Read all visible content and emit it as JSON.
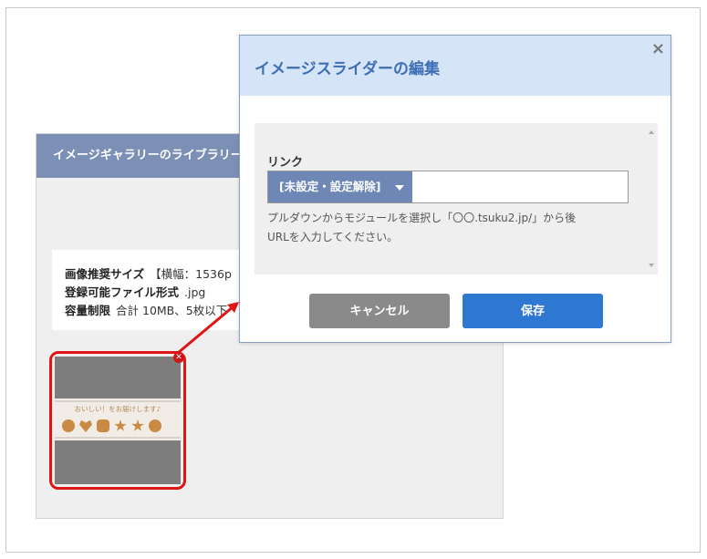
{
  "library_panel": {
    "header_title": "イメージギャラリーのライブラリー",
    "info": {
      "recommended_size_label": "画像推奨サイズ",
      "recommended_size_value": "【横幅：1536p",
      "file_format_label": "登録可能ファイル形式",
      "file_format_value": ".jpg",
      "capacity_label": "容量制限",
      "capacity_value": "合計 10MB、5枚以下"
    },
    "thumbnail": {
      "caption": "おいしい！をお届けします♪"
    }
  },
  "modal": {
    "title": "イメージスライダーの編集",
    "close_symbol": "×",
    "link_label": "リンク",
    "select_value": "[未設定・設定解除]",
    "url_value": "",
    "help_line1": "プルダウンからモジュールを選択し「〇〇.tsuku2.jp/」から後",
    "help_line2": "URLを入力してください。",
    "cancel_label": "キャンセル",
    "save_label": "保存"
  },
  "colors": {
    "accent_blue": "#2f78d2",
    "header_blue": "#d5e4f6",
    "highlight_red": "#e01515"
  }
}
